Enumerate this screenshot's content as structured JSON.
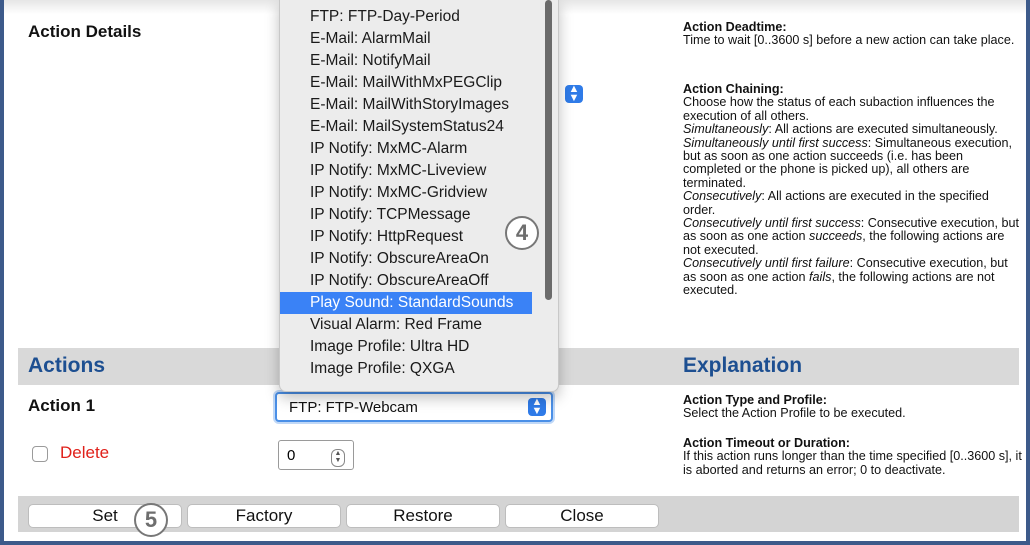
{
  "left": {
    "action_details_label": "Action Details",
    "actions_section_title": "Actions",
    "action_1_label": "Action 1",
    "delete_label": "Delete"
  },
  "fields": {
    "action_select_value": "FTP: FTP-Webcam",
    "timeout_value": "0"
  },
  "dropdown": {
    "items": [
      "FTP: FTP-Day-Period",
      "E-Mail: AlarmMail",
      "E-Mail: NotifyMail",
      "E-Mail: MailWithMxPEGClip",
      "E-Mail: MailWithStoryImages",
      "E-Mail: MailSystemStatus24",
      "IP Notify: MxMC-Alarm",
      "IP Notify: MxMC-Liveview",
      "IP Notify: MxMC-Gridview",
      "IP Notify: TCPMessage",
      "IP Notify: HttpRequest",
      "IP Notify: ObscureAreaOn",
      "IP Notify: ObscureAreaOff",
      "Play Sound: StandardSounds",
      "Visual Alarm: Red Frame",
      "Image Profile: Ultra HD",
      "Image Profile: QXGA"
    ],
    "selected_index": 13
  },
  "help": {
    "deadtime_title": "Action Deadtime",
    "deadtime_text": "Time to wait [0..3600 s] before a new action can take place.",
    "chaining_title": "Action Chaining",
    "chaining_intro": "Choose how the status of each subaction influences the execution of all others.",
    "sim_term": "Simultaneously",
    "sim_text": "All actions are executed simultaneously.",
    "simfirst_term": "Simultaneously until first success",
    "simfirst_text": "Simultaneous execution, but as soon as one action succeeds (i.e. has been completed or the phone is picked up), all others are terminated.",
    "cons_term": "Consecutively",
    "cons_text": "All actions are executed in the specified order.",
    "conssucc_term": "Consecutively until first success",
    "conssucc_text_a": "Consecutive execution, but as soon as one action",
    "conssucc_em": "succeeds",
    "conssucc_text_b": ", the following actions are not executed.",
    "consfail_term": "Consecutively until first failure",
    "consfail_text_a": "Consecutive execution, but as soon as one action",
    "consfail_em": "fails",
    "consfail_text_b": ", the following actions are not executed.",
    "explanation_title": "Explanation",
    "type_title": "Action Type and Profile",
    "type_text": "Select the Action Profile to be executed.",
    "timeout_title": "Action Timeout or Duration",
    "timeout_text": "If this action runs longer than the time specified [0..3600 s], it is aborted and returns an error; 0 to deactivate."
  },
  "buttons": {
    "set": "Set",
    "factory": "Factory",
    "restore": "Restore",
    "close": "Close"
  },
  "callouts": {
    "dropdown_step": "4",
    "set_step": "5"
  }
}
